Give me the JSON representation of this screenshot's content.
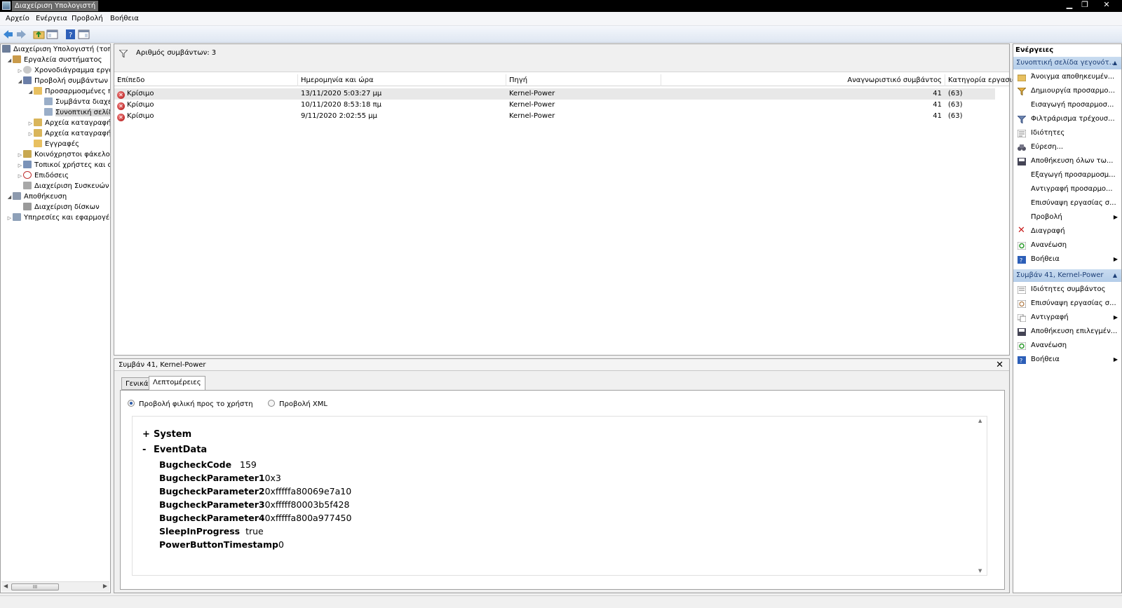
{
  "window": {
    "title": "Διαχείριση Υπολογιστή"
  },
  "menu": {
    "items": [
      "Αρχείο",
      "Ενέργεια",
      "Προβολή",
      "Βοήθεια"
    ]
  },
  "tree": {
    "items": [
      {
        "label": "Διαχείριση Υπολογιστή (τοπικός)",
        "icon": "computer-management-icon"
      },
      {
        "label": "Εργαλεία συστήματος",
        "icon": "tools-icon"
      },
      {
        "label": "Χρονοδιάγραμμα εργασιών",
        "icon": "clock-icon"
      },
      {
        "label": "Προβολή συμβάντων",
        "icon": "event-viewer-icon"
      },
      {
        "label": "Προσαρμοσμένες προβολές",
        "icon": "folder-icon"
      },
      {
        "label": "Συμβάντα διαχείρισης",
        "icon": "filter-icon"
      },
      {
        "label": "Συνοπτική σελίδα",
        "icon": "filter-icon"
      },
      {
        "label": "Αρχεία καταγραφής των Windows",
        "icon": "log-folder-icon"
      },
      {
        "label": "Αρχεία καταγραφής εφαρμογών",
        "icon": "log-folder-icon"
      },
      {
        "label": "Εγγραφές",
        "icon": "folder-icon"
      },
      {
        "label": "Κοινόχρηστοι φάκελοι",
        "icon": "shared-folder-icon"
      },
      {
        "label": "Τοπικοί χρήστες και ομάδες",
        "icon": "users-icon"
      },
      {
        "label": "Επιδόσεις",
        "icon": "performance-icon"
      },
      {
        "label": "Διαχείριση Συσκευών",
        "icon": "device-manager-icon"
      },
      {
        "label": "Αποθήκευση",
        "icon": "storage-icon"
      },
      {
        "label": "Διαχείριση δίσκων",
        "icon": "disk-icon"
      },
      {
        "label": "Υπηρεσίες και εφαρμογές",
        "icon": "services-icon"
      }
    ],
    "scroll_thumb_label": "III"
  },
  "events": {
    "filter_text": "Αριθμός συμβάντων: 3",
    "columns": [
      "Επίπεδο",
      "Ημερομηνία και ώρα",
      "Πηγή",
      "Αναγνωριστικό συμβάντος",
      "Κατηγορία εργασιών"
    ],
    "rows": [
      {
        "level": "Κρίσιμο",
        "datetime": "13/11/2020 5:03:27 μμ",
        "source": "Kernel-Power",
        "id": "41",
        "category": "(63)"
      },
      {
        "level": "Κρίσιμο",
        "datetime": "10/11/2020 8:53:18 πμ",
        "source": "Kernel-Power",
        "id": "41",
        "category": "(63)"
      },
      {
        "level": "Κρίσιμο",
        "datetime": "9/11/2020 2:02:55 μμ",
        "source": "Kernel-Power",
        "id": "41",
        "category": "(63)"
      }
    ]
  },
  "detail": {
    "title": "Συμβάν 41, Kernel-Power",
    "close": "✕",
    "tabs": [
      "Γενικά",
      "Λεπτομέρειες"
    ],
    "radio_friendly": "Προβολή φιλική προς το χρήστη",
    "radio_xml": "Προβολή XML",
    "system_toggle": "+",
    "system_label": "System",
    "eventdata_toggle": "-",
    "eventdata_label": "EventData",
    "fields": [
      {
        "key": "BugcheckCode",
        "value": "159"
      },
      {
        "key": "BugcheckParameter1",
        "value": "0x3"
      },
      {
        "key": "BugcheckParameter2",
        "value": "0xfffffa80069e7a10"
      },
      {
        "key": "BugcheckParameter3",
        "value": "0xfffff80003b5f428"
      },
      {
        "key": "BugcheckParameter4",
        "value": "0xfffffa800a977450"
      },
      {
        "key": "SleepInProgress",
        "value": "true"
      },
      {
        "key": "PowerButtonTimestamp",
        "value": "0"
      }
    ]
  },
  "actions": {
    "title": "Ενέργειες",
    "section1": "Συνοπτική σελίδα γεγονότ...",
    "items1": [
      {
        "label": "Άνοιγμα αποθηκευμέν...",
        "icon": "open-folder-icon"
      },
      {
        "label": "Δημιουργία προσαρμο...",
        "icon": "create-filter-icon"
      },
      {
        "label": "Εισαγωγή προσαρμοσ...",
        "icon": ""
      },
      {
        "label": "Φιλτράρισμα τρέχουσ...",
        "icon": "filter-icon"
      },
      {
        "label": "Ιδιότητες",
        "icon": "properties-icon"
      },
      {
        "label": "Εύρεση...",
        "icon": "binoculars-icon"
      },
      {
        "label": "Αποθήκευση όλων τω...",
        "icon": "save-icon"
      },
      {
        "label": "Εξαγωγή προσαρμοσμ...",
        "icon": ""
      },
      {
        "label": "Αντιγραφή προσαρμο...",
        "icon": ""
      },
      {
        "label": "Επισύναψη εργασίας σ...",
        "icon": ""
      },
      {
        "label": "Προβολή",
        "icon": "",
        "submenu": true
      },
      {
        "label": "Διαγραφή",
        "icon": "delete-icon"
      },
      {
        "label": "Ανανέωση",
        "icon": "refresh-icon"
      },
      {
        "label": "Βοήθεια",
        "icon": "help-icon",
        "submenu": true
      }
    ],
    "section2": "Συμβάν 41, Kernel-Power",
    "items2": [
      {
        "label": "Ιδιότητες συμβάντος",
        "icon": "event-properties-icon"
      },
      {
        "label": "Επισύναψη εργασίας σ...",
        "icon": "attach-task-icon"
      },
      {
        "label": "Αντιγραφή",
        "icon": "copy-icon",
        "submenu": true
      },
      {
        "label": "Αποθήκευση επιλεγμέν...",
        "icon": "save-icon"
      },
      {
        "label": "Ανανέωση",
        "icon": "refresh-icon"
      },
      {
        "label": "Βοήθεια",
        "icon": "help-icon",
        "submenu": true
      }
    ]
  },
  "colors": {
    "accent": "#1d3f77",
    "critical": "#b01010",
    "section_bg": "#c9dcf0"
  }
}
